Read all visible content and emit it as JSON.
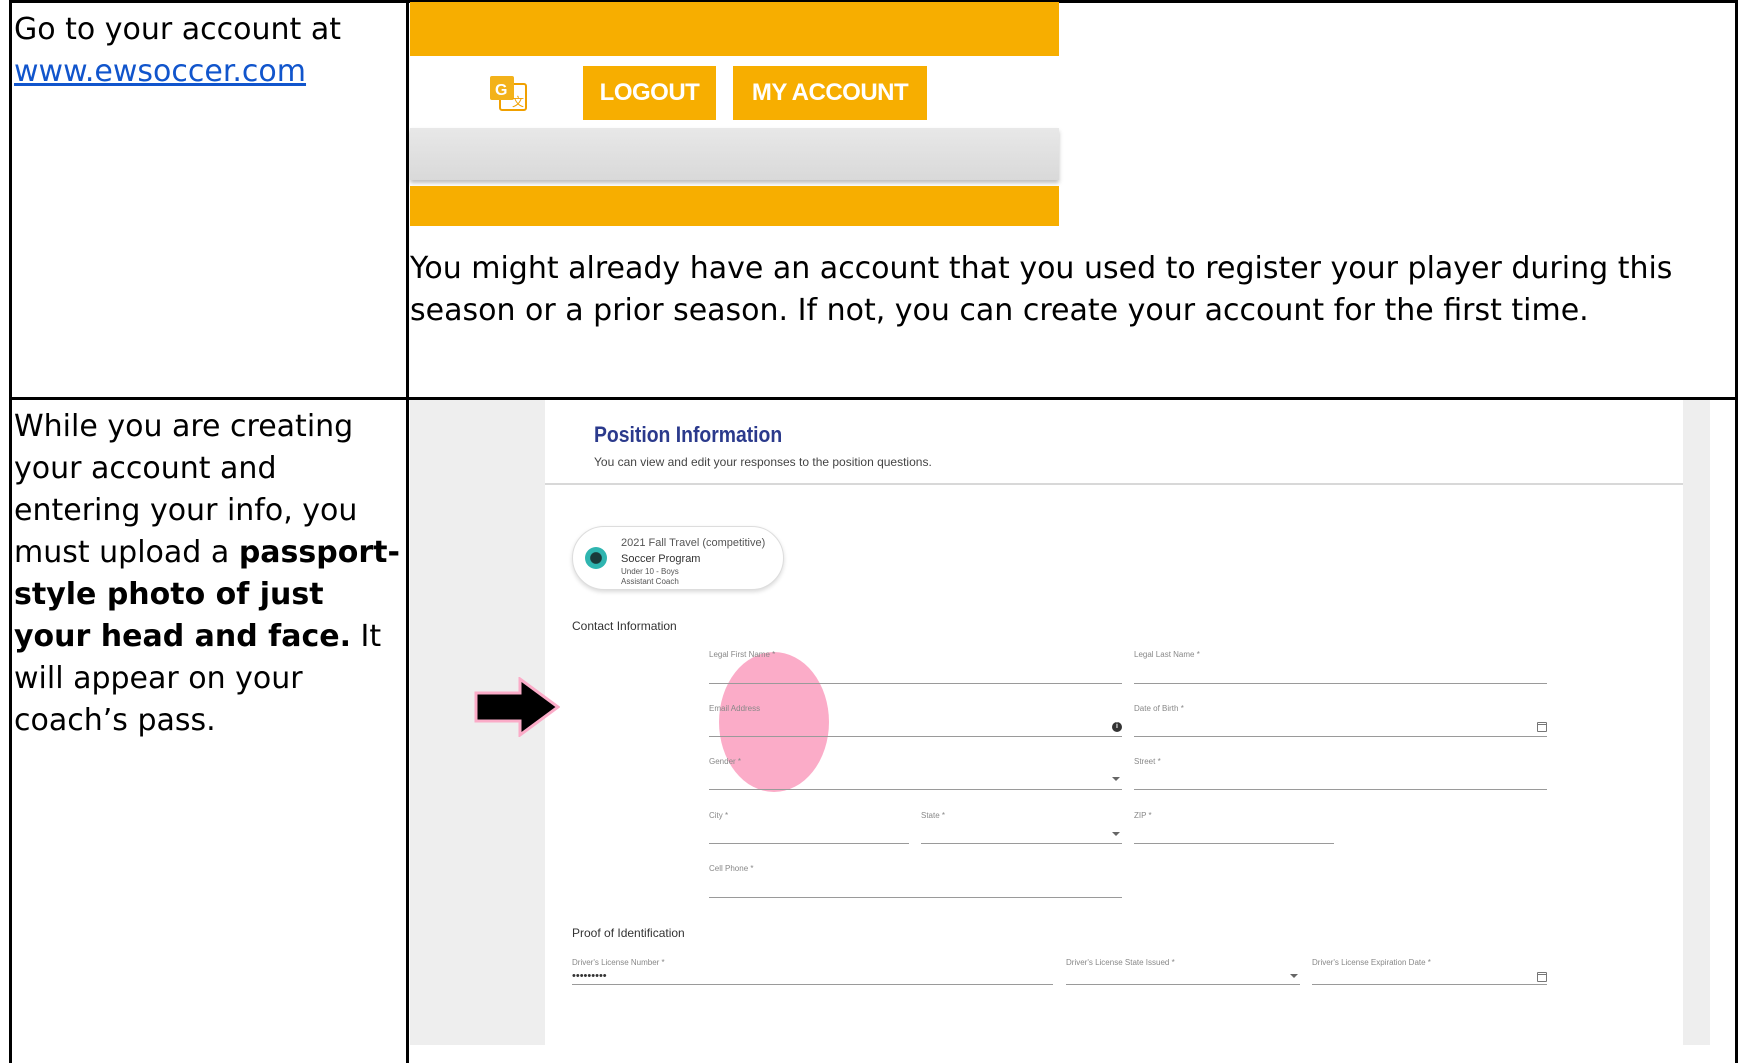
{
  "left_column": {
    "row1_text": "Go to your account at",
    "row1_link": "www.ewsoccer.com",
    "row2_text_1": "While you are creating your account and entering your info, you must upload a",
    "row2_bold": "passport-style photo of just your head and face.",
    "row2_text_2": "It will appear on your coach’s pass."
  },
  "site_header": {
    "logout_label": "LOGOUT",
    "my_account_label": "MY ACCOUNT",
    "translate_icon": "google-translate-icon",
    "brand_color": "#f7ae00"
  },
  "account_note": "You might already have an account that you used to register your player during this season or a prior season. If not, you can create your account for the first time.",
  "form": {
    "title": "Position Information",
    "subtitle": "You can view and edit your responses to the position questions.",
    "program": {
      "line1": "2021 Fall Travel (competitive)",
      "line2": "Soccer Program",
      "line3": "Under 10 - Boys",
      "line4": "Assistant Coach"
    },
    "contact_heading": "Contact Information",
    "fields": {
      "first_name": "Legal First Name *",
      "last_name": "Legal Last Name *",
      "email": "Email Address",
      "dob": "Date of Birth *",
      "gender": "Gender *",
      "street": "Street *",
      "city": "City *",
      "state": "State *",
      "zip": "ZIP *",
      "cell": "Cell Phone *"
    },
    "proof_heading": "Proof of Identification",
    "id_fields": {
      "license_number": "Driver's License Number *",
      "license_number_value": "•••••••••",
      "license_state": "Driver's License State Issued *",
      "license_expiration": "Driver's License Expiration Date *"
    }
  }
}
